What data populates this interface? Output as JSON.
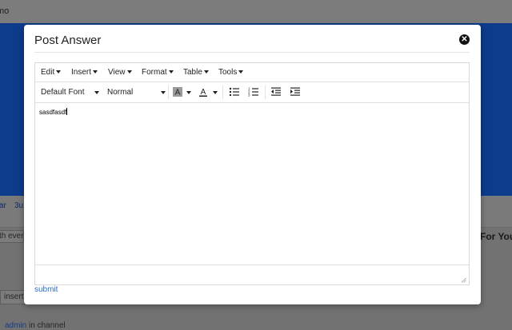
{
  "background": {
    "topbar_text": "mo",
    "tabs": [
      "ar",
      "3u"
    ],
    "search_text": "th every",
    "side_heading": "For You",
    "insert_text": "insert",
    "meta_user": "admin",
    "meta_rest": "in channel"
  },
  "modal": {
    "title": "Post Answer",
    "close_icon": "close-circle-icon",
    "submit_label": "submit"
  },
  "editor": {
    "menus": [
      "Edit",
      "Insert",
      "View",
      "Format",
      "Table",
      "Tools"
    ],
    "font_family": "Default Font",
    "font_size": "Normal",
    "toolbar_icons": [
      "highlight-color-icon",
      "text-color-icon",
      "bullet-list-icon",
      "numbered-list-icon",
      "outdent-icon",
      "indent-icon"
    ],
    "content": "sasdfasdf"
  },
  "colors": {
    "overlay": "#7a7a7a",
    "header_blue": "#0d3c8c",
    "link": "#2a6fc9"
  }
}
